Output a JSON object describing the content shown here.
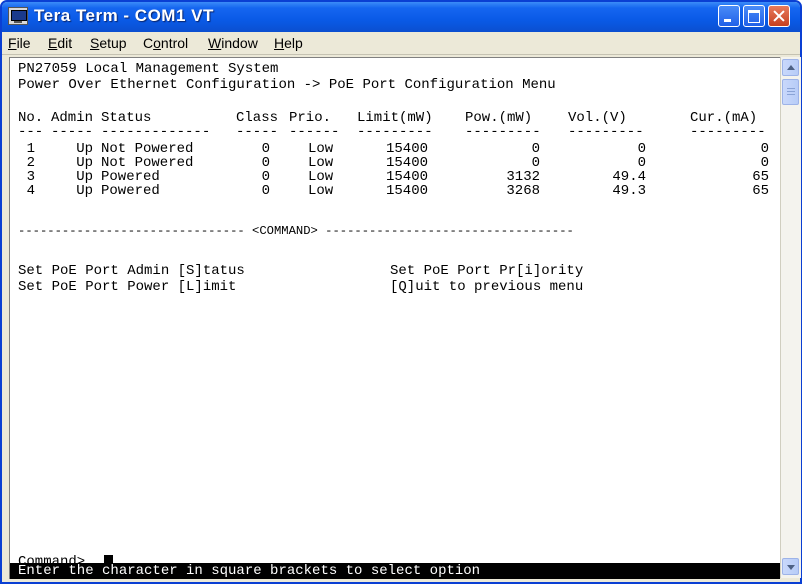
{
  "window": {
    "title": "Tera Term - COM1 VT"
  },
  "menu": [
    {
      "prefix": "",
      "hot": "F",
      "rest": "ile"
    },
    {
      "prefix": "",
      "hot": "E",
      "rest": "dit"
    },
    {
      "prefix": "",
      "hot": "S",
      "rest": "etup"
    },
    {
      "prefix": "C",
      "hot": "o",
      "rest": "ntrol"
    },
    {
      "prefix": "",
      "hot": "W",
      "rest": "indow"
    },
    {
      "prefix": "",
      "hot": "H",
      "rest": "elp"
    }
  ],
  "terminal": {
    "system_name": "PN27059 Local Management System",
    "breadcrumb": "Power Over Ethernet Configuration -> PoE Port Configuration Menu",
    "headers": {
      "no": "No.",
      "admin": "Admin",
      "status": "Status",
      "class": "Class",
      "prio": "Prio.",
      "limit": "Limit(mW)",
      "pow": "Pow.(mW)",
      "vol": "Vol.(V)",
      "cur": "Cur.(mA)"
    },
    "separators": {
      "no": "---",
      "admin": "-----",
      "status": "-------------",
      "class": "-----",
      "prio": "------",
      "limit": "---------",
      "pow": "---------",
      "vol": "---------",
      "cur": "---------"
    },
    "rows": [
      {
        "no": "1",
        "admin": "Up",
        "status": "Not Powered",
        "class": "0",
        "prio": "Low",
        "limit": "15400",
        "pow": "0",
        "vol": "0",
        "cur": "0"
      },
      {
        "no": "2",
        "admin": "Up",
        "status": "Not Powered",
        "class": "0",
        "prio": "Low",
        "limit": "15400",
        "pow": "0",
        "vol": "0",
        "cur": "0"
      },
      {
        "no": "3",
        "admin": "Up",
        "status": "Powered",
        "class": "0",
        "prio": "Low",
        "limit": "15400",
        "pow": "3132",
        "vol": "49.4",
        "cur": "65"
      },
      {
        "no": "4",
        "admin": "Up",
        "status": "Powered",
        "class": "0",
        "prio": "Low",
        "limit": "15400",
        "pow": "3268",
        "vol": "49.3",
        "cur": "65"
      }
    ],
    "command_divider": "------------------------------- <COMMAND> ----------------------------------",
    "commands": {
      "admin_status": "Set PoE Port Admin [S]tatus",
      "priority": "Set PoE Port Pr[i]ority",
      "power_limit": "Set PoE Port Power [L]imit",
      "quit": "[Q]uit to previous menu"
    },
    "prompt": "Command>",
    "status_line": "Enter the character in square brackets to select option"
  }
}
